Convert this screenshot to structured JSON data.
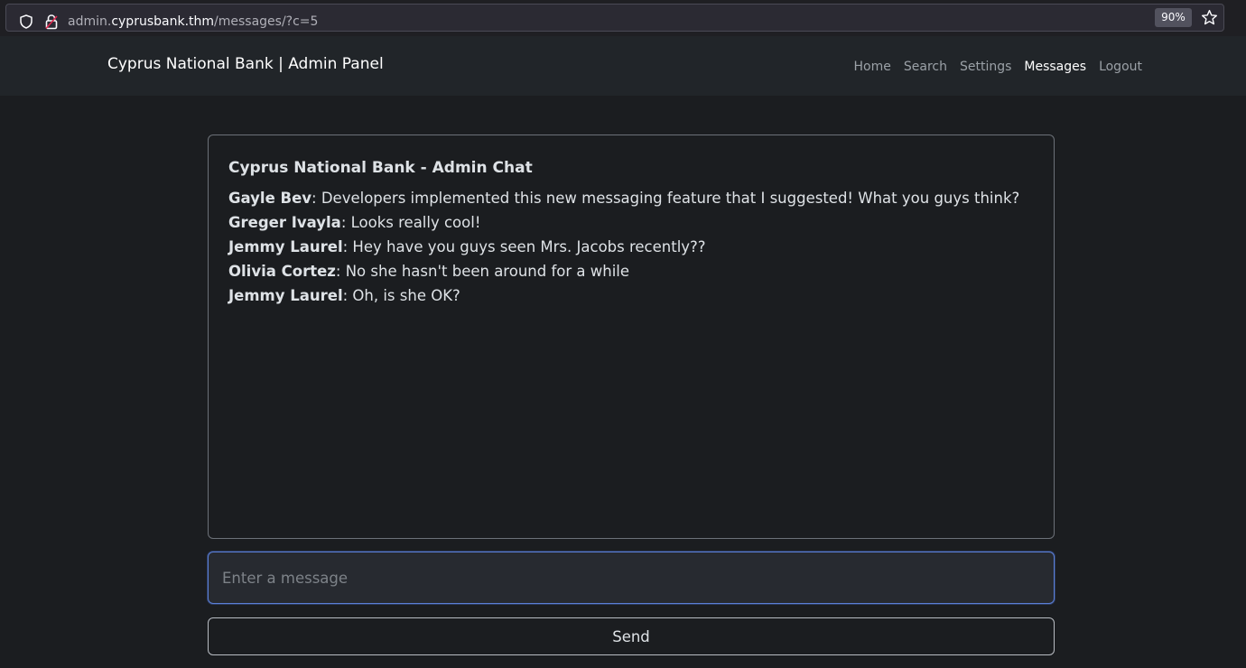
{
  "browser": {
    "url_prefix": "admin.",
    "url_host": "cyprusbank.thm",
    "url_path": "/messages/?c=5",
    "zoom": "90%",
    "icons": [
      "shield-icon",
      "lock-icon",
      "star-icon"
    ]
  },
  "navbar": {
    "brand": "Cyprus National Bank | Admin Panel",
    "links": [
      {
        "label": "Home",
        "active": false
      },
      {
        "label": "Search",
        "active": false
      },
      {
        "label": "Settings",
        "active": false
      },
      {
        "label": "Messages",
        "active": true
      },
      {
        "label": "Logout",
        "active": false
      }
    ]
  },
  "chat": {
    "title": "Cyprus National Bank - Admin Chat",
    "messages": [
      {
        "author": "Gayle Bev",
        "text": ": Developers implemented this new messaging feature that I suggested! What you guys think?"
      },
      {
        "author": "Greger Ivayla",
        "text": ": Looks really cool!"
      },
      {
        "author": "Jemmy Laurel",
        "text": ": Hey have you guys seen Mrs. Jacobs recently??"
      },
      {
        "author": "Olivia Cortez",
        "text": ": No she hasn't been around for a while"
      },
      {
        "author": "Jemmy Laurel",
        "text": ": Oh, is she OK?"
      }
    ]
  },
  "composer": {
    "placeholder": "Enter a message",
    "value": "",
    "send_label": "Send"
  },
  "colors": {
    "page_bg": "#1b1d20",
    "navbar_bg": "#212529",
    "focus_border": "#5b7fd6"
  }
}
